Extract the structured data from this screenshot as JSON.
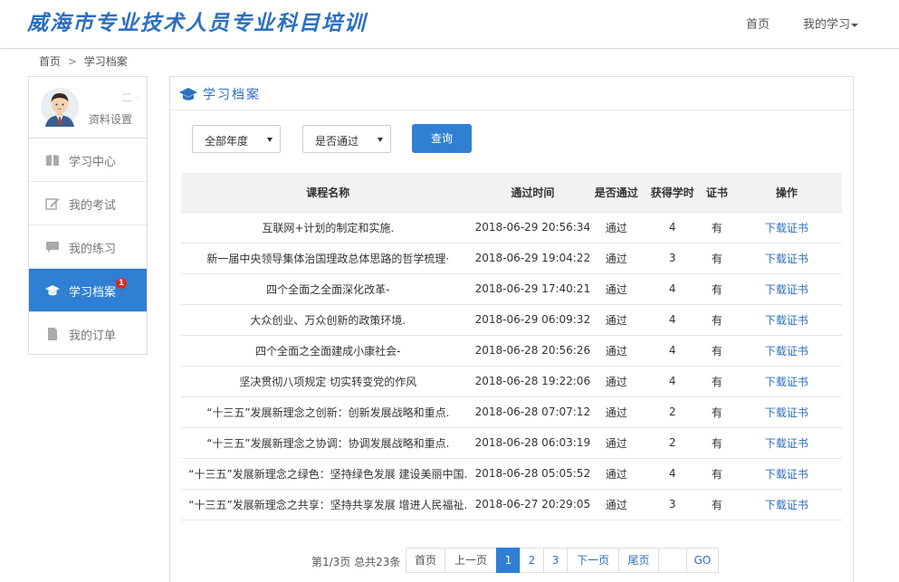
{
  "header": {
    "logo_text": "威海市专业技术人员专业科目培训",
    "nav_home": "首页",
    "nav_my_study": "我的学习"
  },
  "breadcrumb": {
    "home": "首页",
    "separator": ">",
    "current": "学习档案"
  },
  "sidebar": {
    "user_name": "二 ·",
    "settings_label": "资料设置",
    "items": [
      {
        "label": "学习中心",
        "icon": "book-icon"
      },
      {
        "label": "我的考试",
        "icon": "edit-icon"
      },
      {
        "label": "我的练习",
        "icon": "comment-icon"
      },
      {
        "label": "学习档案",
        "icon": "graduation-cap-icon",
        "active": true,
        "badge": "1"
      },
      {
        "label": "我的订单",
        "icon": "document-icon"
      }
    ]
  },
  "panel": {
    "title": "学习档案",
    "filters": {
      "year_select": "全部年度",
      "pass_select": "是否通过",
      "query_button": "查询"
    },
    "table": {
      "headers": [
        "课程名称",
        "通过时间",
        "是否通过",
        "获得学时",
        "证书",
        "操作"
      ],
      "rows": [
        [
          "互联网+计划的制定和实施.",
          "2018-06-29 20:56:34",
          "通过",
          "4",
          "有",
          "下载证书"
        ],
        [
          "新一届中央领导集体治国理政总体思路的哲学梳理·",
          "2018-06-29 19:04:22",
          "通过",
          "3",
          "有",
          "下载证书"
        ],
        [
          "四个全面之全面深化改革-",
          "2018-06-29 17:40:21",
          "通过",
          "4",
          "有",
          "下载证书"
        ],
        [
          "大众创业、万众创新的政策环境.",
          "2018-06-29 06:09:32",
          "通过",
          "4",
          "有",
          "下载证书"
        ],
        [
          "四个全面之全面建成小康社会-",
          "2018-06-28 20:56:26",
          "通过",
          "4",
          "有",
          "下载证书"
        ],
        [
          "坚决贯彻八项规定 切实转变党的作风",
          "2018-06-28 19:22:06",
          "通过",
          "4",
          "有",
          "下载证书"
        ],
        [
          "“十三五”发展新理念之创新：创新发展战略和重点.",
          "2018-06-28 07:07:12",
          "通过",
          "2",
          "有",
          "下载证书"
        ],
        [
          "“十三五”发展新理念之协调：协调发展战略和重点.",
          "2018-06-28 06:03:19",
          "通过",
          "2",
          "有",
          "下载证书"
        ],
        [
          "“十三五”发展新理念之绿色：坚持绿色发展 建设美丽中国.",
          "2018-06-28 05:05:52",
          "通过",
          "4",
          "有",
          "下载证书"
        ],
        [
          "“十三五”发展新理念之共享：坚持共享发展 增进人民福祉.",
          "2018-06-27 20:29:05",
          "通过",
          "3",
          "有",
          "下载证书"
        ]
      ]
    },
    "pagination": {
      "info": "第1/3页 总共23条",
      "first": "首页",
      "prev": "上一页",
      "pages": [
        "1",
        "2",
        "3"
      ],
      "current_page": "1",
      "next": "下一页",
      "last": "尾页",
      "jump_value": "",
      "go": "GO"
    }
  },
  "colors": {
    "brand_blue": "#2f7fd4",
    "link_blue": "#2c6fbf",
    "badge_red": "#e2261d"
  }
}
